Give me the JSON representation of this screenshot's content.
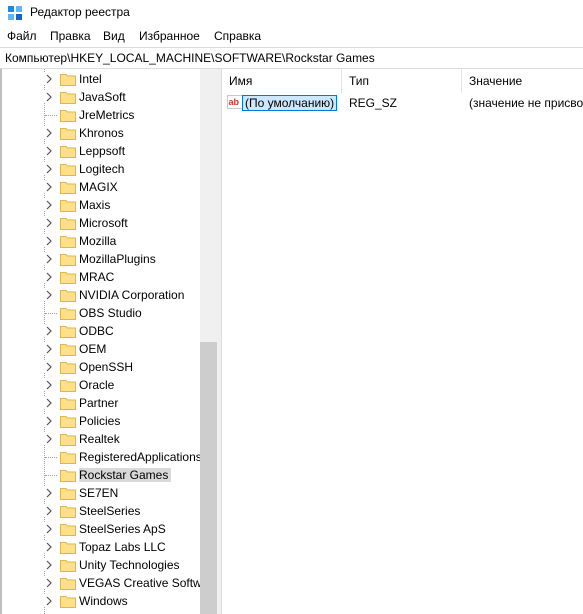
{
  "window": {
    "title": "Редактор реестра"
  },
  "menu": [
    "Файл",
    "Правка",
    "Вид",
    "Избранное",
    "Справка"
  ],
  "address": "Компьютер\\HKEY_LOCAL_MACHINE\\SOFTWARE\\Rockstar Games",
  "tree": {
    "items": [
      {
        "label": "Intel",
        "expandable": true
      },
      {
        "label": "JavaSoft",
        "expandable": true
      },
      {
        "label": "JreMetrics",
        "expandable": false
      },
      {
        "label": "Khronos",
        "expandable": true
      },
      {
        "label": "Leppsoft",
        "expandable": true
      },
      {
        "label": "Logitech",
        "expandable": true
      },
      {
        "label": "MAGIX",
        "expandable": true
      },
      {
        "label": "Maxis",
        "expandable": true
      },
      {
        "label": "Microsoft",
        "expandable": true
      },
      {
        "label": "Mozilla",
        "expandable": true
      },
      {
        "label": "MozillaPlugins",
        "expandable": true
      },
      {
        "label": "MRAC",
        "expandable": true
      },
      {
        "label": "NVIDIA Corporation",
        "expandable": true
      },
      {
        "label": "OBS Studio",
        "expandable": false
      },
      {
        "label": "ODBC",
        "expandable": true
      },
      {
        "label": "OEM",
        "expandable": true
      },
      {
        "label": "OpenSSH",
        "expandable": true
      },
      {
        "label": "Oracle",
        "expandable": true
      },
      {
        "label": "Partner",
        "expandable": true
      },
      {
        "label": "Policies",
        "expandable": true
      },
      {
        "label": "Realtek",
        "expandable": true
      },
      {
        "label": "RegisteredApplications",
        "expandable": false
      },
      {
        "label": "Rockstar Games",
        "expandable": false,
        "selected": true
      },
      {
        "label": "SE7EN",
        "expandable": true
      },
      {
        "label": "SteelSeries",
        "expandable": true
      },
      {
        "label": "SteelSeries ApS",
        "expandable": true
      },
      {
        "label": "Topaz Labs LLC",
        "expandable": true
      },
      {
        "label": "Unity Technologies",
        "expandable": true
      },
      {
        "label": "VEGAS Creative Software",
        "expandable": true
      },
      {
        "label": "Windows",
        "expandable": true
      }
    ]
  },
  "values_pane": {
    "columns": [
      "Имя",
      "Тип",
      "Значение"
    ],
    "rows": [
      {
        "name": "(По умолчанию)",
        "type": "REG_SZ",
        "data": "(значение не присвоено)",
        "icon": "string-value-icon"
      }
    ]
  },
  "colors": {
    "folder": "#ffe08a",
    "folder_outline": "#e0b64a",
    "selection": "#cce8ff",
    "selection_border": "#0078d7",
    "tree_highlight": "#d9d9d9"
  }
}
